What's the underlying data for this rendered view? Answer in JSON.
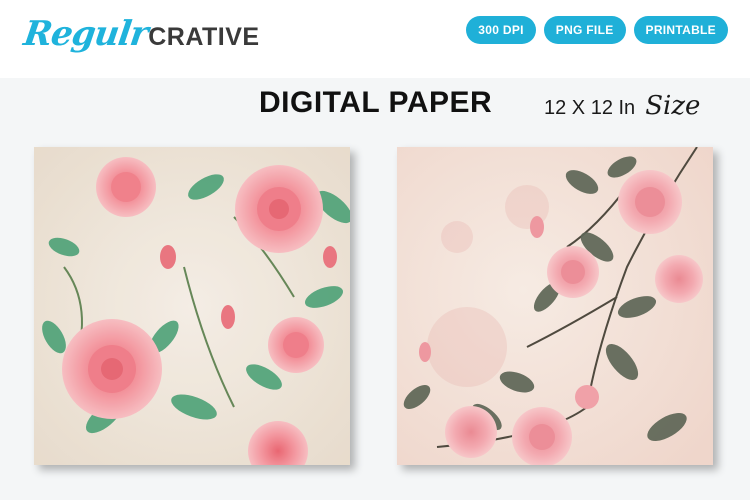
{
  "brand": {
    "script_text": "Regulr",
    "block_text": "CRATIVE",
    "accent_color": "#1fb3dc",
    "dark_color": "#3a3a3a"
  },
  "badges": [
    {
      "label": "300 DPI"
    },
    {
      "label": "PNG FILE"
    },
    {
      "label": "PRINTABLE"
    }
  ],
  "headline": {
    "title": "DIGITAL PAPER",
    "size_prefix": "12 X 12 In",
    "size_word": "Size"
  },
  "previews": [
    {
      "name": "pink rose watercolor paper",
      "background": "#f1e7dc",
      "rose_color": "#f08a92",
      "leaf_color": "#3f9a6c"
    },
    {
      "name": "vintage rose corner paper",
      "background": "#f5e4dc",
      "rose_color": "#f2a0a8",
      "leaf_color": "#5e6656"
    }
  ]
}
